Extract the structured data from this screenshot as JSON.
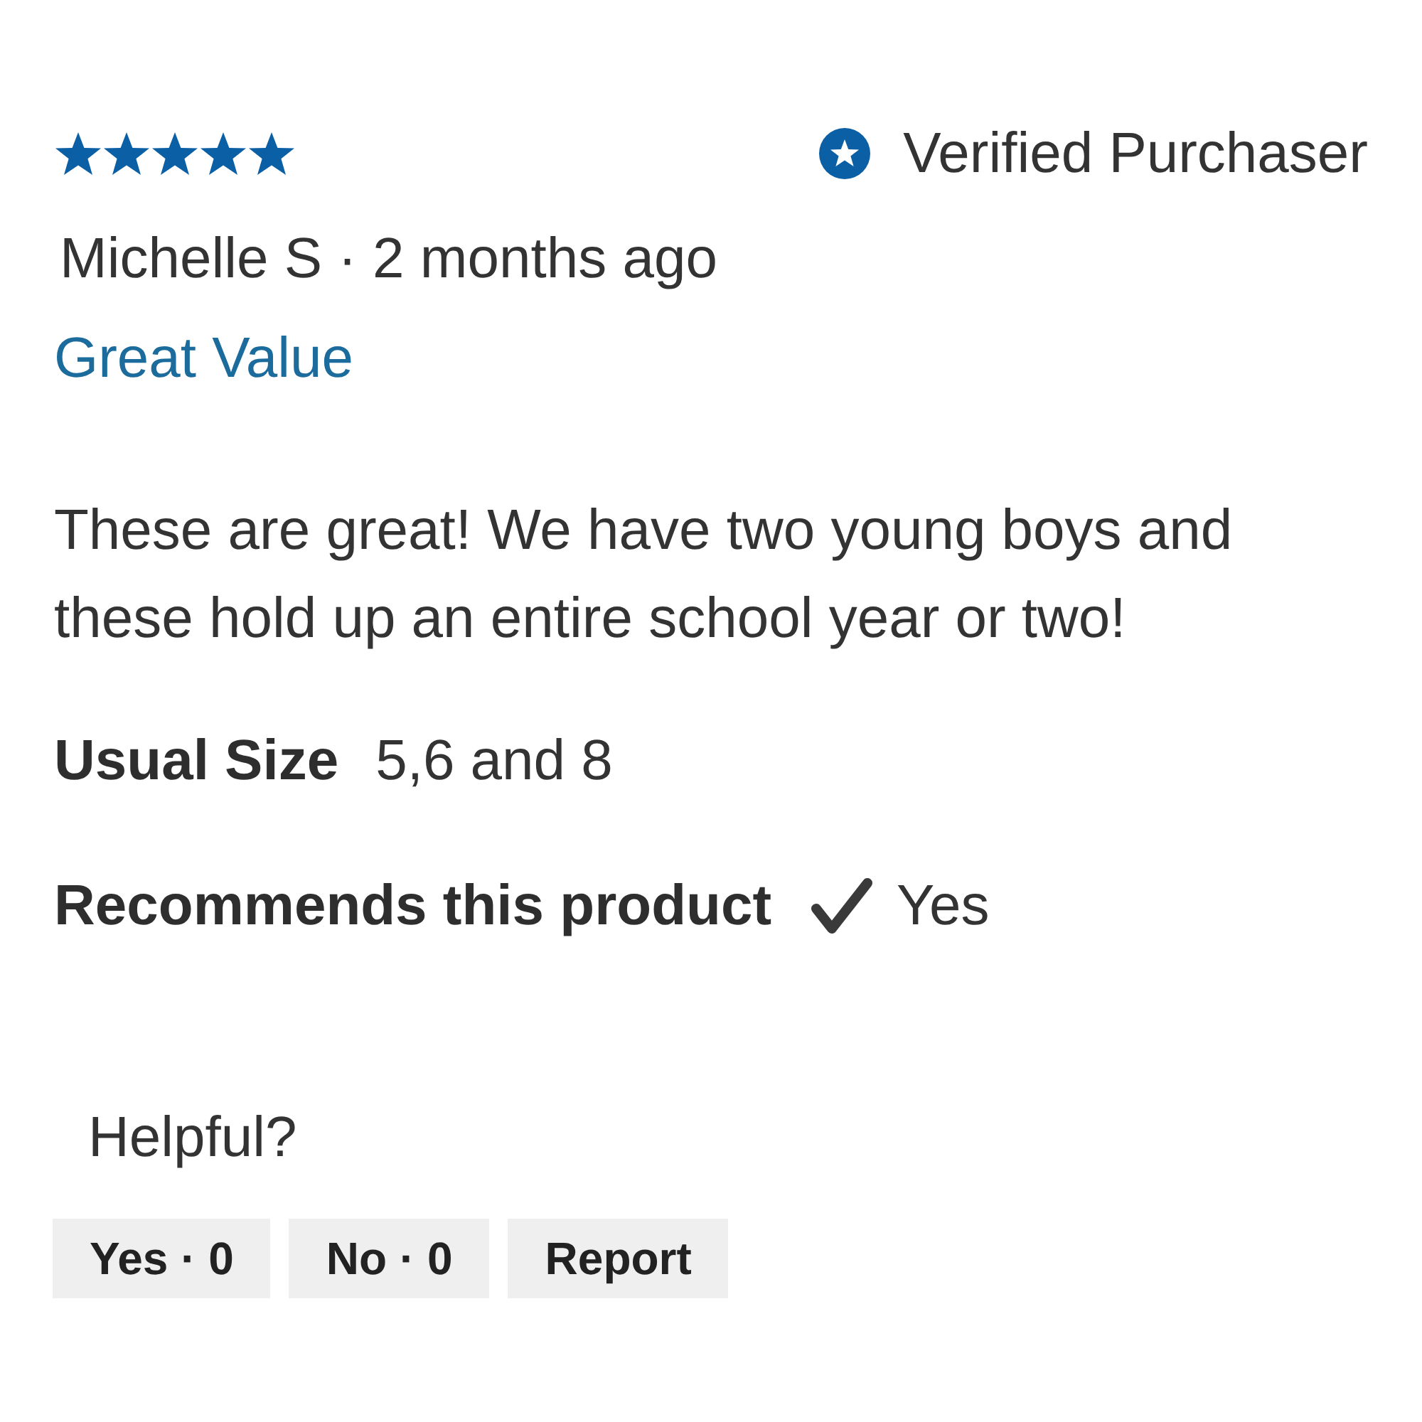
{
  "review": {
    "stars": 5,
    "badge": "Verified Purchaser",
    "byline": "Michelle S · 2 months ago",
    "title": "Great Value",
    "body": "These are great! We have two young boys and these hold up an entire school year or two!"
  },
  "details": [
    {
      "kind": "text",
      "label": "Usual Size",
      "value": "5,6 and 8"
    },
    {
      "kind": "tick",
      "label": "Recommends this product",
      "value": "Yes"
    }
  ],
  "helpful": {
    "prompt": "Helpful?",
    "buttons": [
      "Yes · 0",
      "No · 0",
      "Report"
    ]
  }
}
